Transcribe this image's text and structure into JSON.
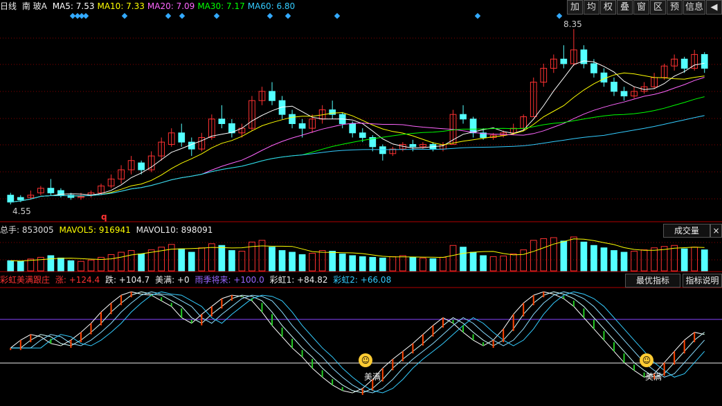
{
  "header": {
    "period": "日线",
    "stock": "南 玻A",
    "ma": [
      {
        "label": "MA5: 7.53",
        "color": "#ffffff"
      },
      {
        "label": "MA10: 7.33",
        "color": "#ffff00"
      },
      {
        "label": "MA20: 7.09",
        "color": "#ff66ff"
      },
      {
        "label": "MA30: 7.17",
        "color": "#00ff00"
      },
      {
        "label": "MA60: 6.80",
        "color": "#33ccff"
      }
    ]
  },
  "toolbar": [
    "加",
    "均",
    "权",
    "叠",
    "窗",
    "区",
    "预",
    "信息",
    "◀"
  ],
  "price_panel": {
    "high_label": "8.35",
    "low_label": "4.55",
    "marker": "q"
  },
  "volume_panel": {
    "total_label": "总手: 853005",
    "mavol5_label": "MAVOL5: 916941",
    "mavol10_label": "MAVOL10: 898091",
    "button": "成交量"
  },
  "indicator_panel": {
    "name": "彩虹美满跟庄",
    "zhang": "涨: +124.4",
    "die": "跌: +104.7",
    "meiman": "美满: +0",
    "yuji": "雨季将来: +100.0",
    "caihong1": "彩虹1: +84.82",
    "caihong2": "彩虹2: +66.08",
    "btn_best": "最优指标",
    "btn_help": "指标说明",
    "annotations": [
      "美满",
      "美满"
    ]
  },
  "colors": {
    "up": "#ff3232",
    "down": "#54ffff",
    "grid": "#8b0000"
  },
  "chart_data": {
    "type": "candlestick",
    "candles": [
      [
        4.75,
        4.8,
        4.6,
        4.55
      ],
      [
        4.7,
        4.75,
        4.65,
        4.6
      ],
      [
        4.7,
        4.85,
        4.75,
        4.65
      ],
      [
        4.8,
        4.95,
        4.9,
        4.75
      ],
      [
        4.9,
        5.1,
        4.8,
        4.75
      ],
      [
        4.85,
        4.9,
        4.75,
        4.7
      ],
      [
        4.75,
        4.8,
        4.7,
        4.65
      ],
      [
        4.7,
        4.8,
        4.72,
        4.65
      ],
      [
        4.75,
        4.85,
        4.8,
        4.7
      ],
      [
        4.8,
        5.0,
        4.95,
        4.75
      ],
      [
        4.95,
        5.2,
        5.1,
        4.9
      ],
      [
        5.1,
        5.4,
        5.3,
        5.0
      ],
      [
        5.3,
        5.6,
        5.5,
        5.2
      ],
      [
        5.45,
        5.5,
        5.3,
        5.2
      ],
      [
        5.3,
        5.7,
        5.6,
        5.25
      ],
      [
        5.6,
        6.0,
        5.9,
        5.5
      ],
      [
        5.85,
        6.2,
        6.1,
        5.8
      ],
      [
        6.1,
        6.3,
        5.9,
        5.8
      ],
      [
        5.9,
        6.0,
        5.75,
        5.6
      ],
      [
        5.75,
        6.1,
        6.0,
        5.7
      ],
      [
        6.0,
        6.5,
        6.4,
        5.95
      ],
      [
        6.4,
        6.7,
        6.3,
        6.2
      ],
      [
        6.3,
        6.4,
        6.1,
        6.0
      ],
      [
        6.1,
        6.3,
        6.2,
        6.0
      ],
      [
        6.2,
        6.9,
        6.8,
        6.15
      ],
      [
        6.8,
        7.1,
        7.0,
        6.7
      ],
      [
        7.0,
        7.2,
        6.8,
        6.7
      ],
      [
        6.8,
        6.9,
        6.5,
        6.4
      ],
      [
        6.5,
        6.6,
        6.3,
        6.2
      ],
      [
        6.3,
        6.4,
        6.2,
        6.0
      ],
      [
        6.2,
        6.5,
        6.4,
        6.1
      ],
      [
        6.4,
        6.7,
        6.6,
        6.3
      ],
      [
        6.6,
        6.8,
        6.5,
        6.4
      ],
      [
        6.5,
        6.55,
        6.3,
        6.2
      ],
      [
        6.3,
        6.35,
        6.1,
        6.0
      ],
      [
        6.1,
        6.2,
        6.0,
        5.9
      ],
      [
        6.0,
        6.05,
        5.8,
        5.7
      ],
      [
        5.8,
        5.85,
        5.65,
        5.5
      ],
      [
        5.65,
        5.8,
        5.75,
        5.6
      ],
      [
        5.75,
        5.9,
        5.85,
        5.7
      ],
      [
        5.85,
        5.95,
        5.8,
        5.7
      ],
      [
        5.8,
        5.9,
        5.85,
        5.75
      ],
      [
        5.85,
        5.9,
        5.75,
        5.7
      ],
      [
        5.75,
        5.9,
        5.85,
        5.7
      ],
      [
        5.85,
        6.6,
        6.5,
        5.85
      ],
      [
        6.5,
        6.7,
        6.4,
        6.3
      ],
      [
        6.4,
        6.45,
        6.1,
        6.0
      ],
      [
        6.1,
        6.2,
        6.0,
        5.95
      ],
      [
        6.0,
        6.1,
        6.05,
        5.95
      ],
      [
        6.05,
        6.15,
        6.1,
        6.0
      ],
      [
        6.1,
        6.3,
        6.2,
        6.05
      ],
      [
        6.2,
        6.5,
        6.45,
        6.15
      ],
      [
        6.45,
        7.3,
        7.2,
        6.45
      ],
      [
        7.2,
        7.6,
        7.5,
        7.1
      ],
      [
        7.5,
        7.8,
        7.7,
        7.4
      ],
      [
        7.7,
        8.0,
        7.6,
        7.5
      ],
      [
        7.6,
        8.35,
        7.9,
        7.55
      ],
      [
        7.9,
        8.0,
        7.6,
        7.5
      ],
      [
        7.6,
        7.7,
        7.4,
        7.3
      ],
      [
        7.4,
        7.5,
        7.2,
        7.1
      ],
      [
        7.2,
        7.3,
        7.0,
        6.9
      ],
      [
        7.0,
        7.1,
        6.9,
        6.8
      ],
      [
        6.9,
        7.1,
        7.0,
        6.85
      ],
      [
        7.0,
        7.2,
        7.1,
        6.95
      ],
      [
        7.1,
        7.4,
        7.3,
        7.05
      ],
      [
        7.3,
        7.6,
        7.55,
        7.25
      ],
      [
        7.55,
        7.8,
        7.7,
        7.45
      ],
      [
        7.7,
        7.75,
        7.5,
        7.4
      ],
      [
        7.5,
        7.9,
        7.8,
        7.45
      ],
      [
        7.8,
        7.85,
        7.5,
        7.4
      ]
    ],
    "volumes": [
      30,
      28,
      35,
      40,
      45,
      38,
      30,
      28,
      32,
      40,
      48,
      55,
      60,
      50,
      62,
      70,
      78,
      65,
      55,
      68,
      80,
      75,
      60,
      58,
      85,
      90,
      70,
      60,
      55,
      48,
      52,
      60,
      58,
      50,
      45,
      42,
      40,
      38,
      42,
      45,
      40,
      38,
      36,
      40,
      75,
      70,
      55,
      45,
      42,
      44,
      50,
      62,
      90,
      95,
      98,
      88,
      100,
      85,
      75,
      68,
      60,
      55,
      58,
      62,
      68,
      72,
      75,
      65,
      70,
      62
    ],
    "indicator": [
      48,
      55,
      60,
      58,
      52,
      50,
      55,
      62,
      70,
      80,
      88,
      95,
      98,
      96,
      95,
      90,
      85,
      75,
      70,
      78,
      85,
      92,
      95,
      94,
      90,
      80,
      68,
      58,
      48,
      40,
      30,
      22,
      15,
      10,
      8,
      12,
      20,
      30,
      38,
      45,
      52,
      60,
      68,
      75,
      70,
      62,
      55,
      50,
      55,
      65,
      78,
      88,
      95,
      98,
      96,
      92,
      85,
      75,
      65,
      55,
      45,
      35,
      28,
      22,
      25,
      35,
      45,
      55,
      62,
      60
    ]
  }
}
